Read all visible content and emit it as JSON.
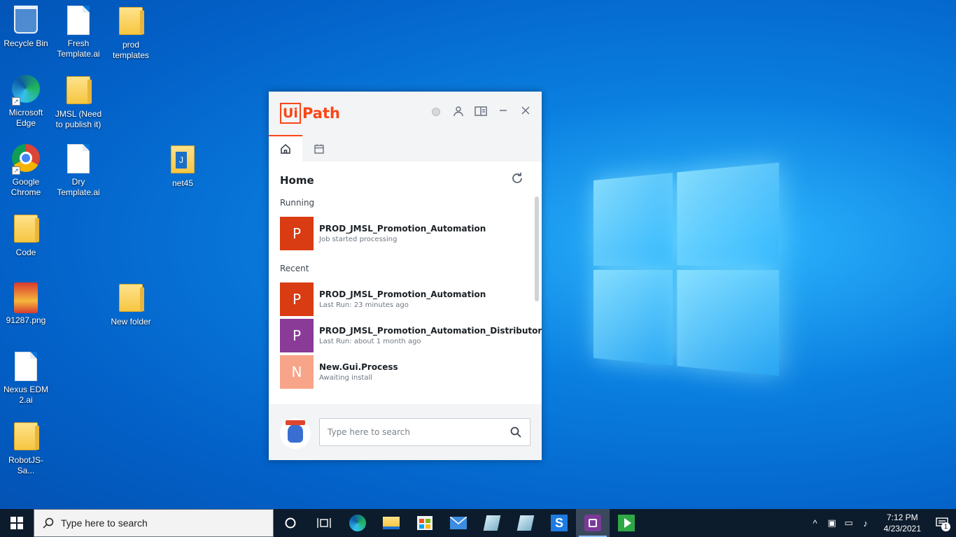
{
  "desktop": {
    "icons": [
      {
        "label": "Recycle Bin"
      },
      {
        "label": "Fresh Template.ai"
      },
      {
        "label": "prod templates"
      },
      {
        "label": "Microsoft Edge"
      },
      {
        "label": "JMSL (Need to publish it)"
      },
      {
        "label": "Google Chrome"
      },
      {
        "label": "Dry Template.ai"
      },
      {
        "label": "net45"
      },
      {
        "label": "Code"
      },
      {
        "label": "91287.png"
      },
      {
        "label": "New folder"
      },
      {
        "label": "Nexus EDM 2.ai"
      },
      {
        "label": "RobotJS-Sa..."
      }
    ]
  },
  "uipath": {
    "logo_ui": "Ui",
    "logo_path": "Path",
    "title": "Home",
    "running_label": "Running",
    "recent_label": "Recent",
    "running": [
      {
        "badge": "P",
        "color": "#d93b12",
        "name": "PROD_JMSL_Promotion_Automation",
        "status": "Job started processing"
      }
    ],
    "recent": [
      {
        "badge": "P",
        "color": "#d93b12",
        "name": "PROD_JMSL_Promotion_Automation",
        "status": "Last Run: 23 minutes ago"
      },
      {
        "badge": "P",
        "color": "#8a3a97",
        "name": "PROD_JMSL_Promotion_Automation_Distributor",
        "status": "Last Run: about 1 month ago"
      },
      {
        "badge": "N",
        "color": "#f7a488",
        "name": "New.Gui.Process",
        "status": "Awaiting install"
      }
    ],
    "search_placeholder": "Type here to search",
    "brand_color": "#fa4616"
  },
  "taskbar": {
    "search_placeholder": "Type here to search",
    "time": "7:12 PM",
    "date": "4/23/2021",
    "notification_count": "1"
  }
}
